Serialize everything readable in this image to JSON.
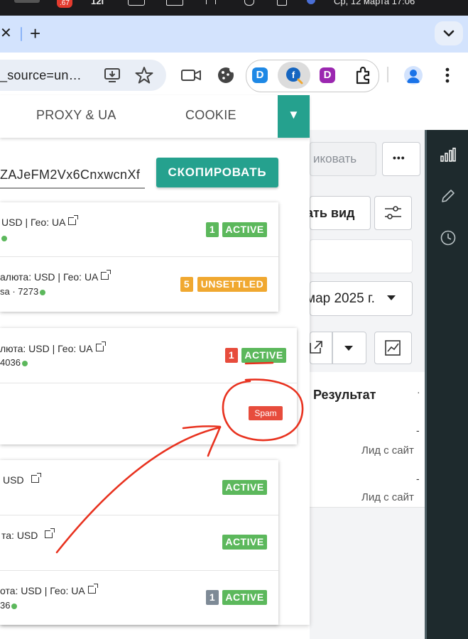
{
  "os_bar": {
    "badge": ".67",
    "item1": "12I",
    "date_text": "Ср, 12 марта   17:06"
  },
  "browser": {
    "tab_close": "✕",
    "new_tab": "+",
    "url_fragment": "_source=un…",
    "extensions": [
      "D",
      "D"
    ],
    "colors": {
      "tabstrip": "#d3e3fd",
      "accent": "#25a18e"
    }
  },
  "popup": {
    "tabs": [
      "PROXY & UA",
      "COOKIE"
    ],
    "dropdown_icon": "▼",
    "token_value": "ZAJeFM2Vx6CnxwcnXf",
    "copy_button": "СКОПИРОВАТЬ",
    "card1": {
      "row1": {
        "line1": "USD | Гео: UA",
        "badge_num": "1",
        "status": "ACTIVE"
      },
      "row2": {
        "line1": "алюта: USD | Гео: UA",
        "line2": "sa · 7273",
        "badge_num": "5",
        "status": "UNSETTLED"
      }
    },
    "card2": {
      "row1": {
        "line1": "люта: USD | Гео: UA",
        "line2": "4036",
        "badge_num": "1",
        "status": "ACTIVE"
      },
      "row2": {
        "tag": "Spam"
      }
    },
    "card3": {
      "row1": {
        "line1": "USD",
        "status": "ACTIVE"
      },
      "row2": {
        "line1": "та: USD",
        "status": "ACTIVE"
      },
      "row3": {
        "line1": "ота: USD | Гео: UA",
        "line2": "36",
        "badge_num": "1",
        "status": "ACTIVE"
      }
    }
  },
  "page": {
    "button_partial": "иковать",
    "more": "•••",
    "view_button": "ать вид",
    "date_select": "мар 2025 г.",
    "column_header": "Результат",
    "rows": [
      {
        "dash": "-",
        "text": "Лид с сайт"
      },
      {
        "dash": "-",
        "text": "Лид с сайт"
      }
    ]
  }
}
